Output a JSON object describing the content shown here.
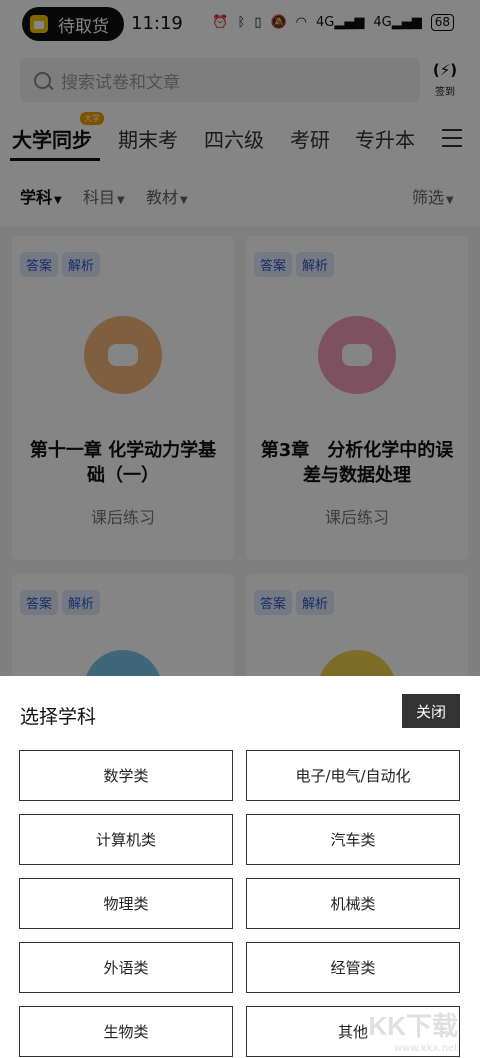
{
  "status_bar": {
    "pill_label": "待取货",
    "time": "11:19",
    "icons": [
      "alarm-icon",
      "bluetooth-icon",
      "vibrate-icon",
      "mute-icon",
      "wifi-icon",
      "signal-icon",
      "signal-icon"
    ],
    "signal_labels": [
      "4G",
      "4G"
    ],
    "battery": "68"
  },
  "search": {
    "placeholder": "搜索试卷和文章",
    "signin_icon": "(⚡)",
    "signin_label": "签到"
  },
  "tabs": {
    "items": [
      "大学同步",
      "期末考",
      "四六级",
      "考研",
      "专升本"
    ],
    "badge": "大学",
    "active_index": 0
  },
  "filters": {
    "subject": "学科",
    "course": "科目",
    "textbook": "教材",
    "screen": "筛选"
  },
  "cards": [
    {
      "tag1": "答案",
      "tag2": "解析",
      "title": "第十一章 化学动力学基础（一）",
      "subtitle": "课后练习",
      "icon": "candy-icon",
      "icon_color": "#f6b77c"
    },
    {
      "tag1": "答案",
      "tag2": "解析",
      "title": "第3章　分析化学中的误差与数据处理",
      "subtitle": "课后练习",
      "icon": "chef-hat-icon",
      "icon_color": "#f29bb8"
    },
    {
      "tag1": "答案",
      "tag2": "解析",
      "icon": "globe-icon",
      "icon_color": "#7cc5e8"
    },
    {
      "tag1": "答案",
      "tag2": "解析",
      "icon": "coin-icon",
      "icon_color": "#f2d24f"
    }
  ],
  "sheet": {
    "title": "选择学科",
    "close": "关闭",
    "subjects": [
      "数学类",
      "电子/电气/自动化",
      "计算机类",
      "汽车类",
      "物理类",
      "机械类",
      "外语类",
      "经管类",
      "生物类",
      "其他"
    ]
  },
  "watermark": {
    "big": "KK下载",
    "small": "www.kkx.net"
  }
}
